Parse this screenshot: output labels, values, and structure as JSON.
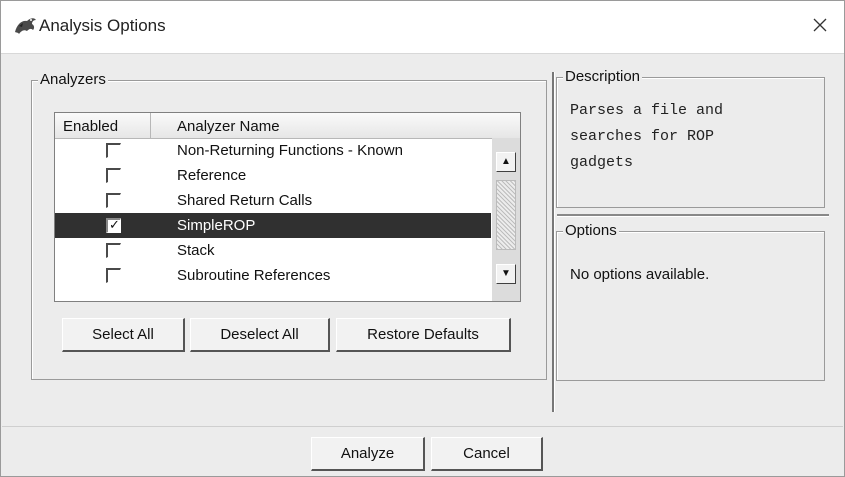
{
  "window": {
    "title": "Analysis Options",
    "icon": "dragon-icon",
    "close_glyph": "✕"
  },
  "analyzers": {
    "legend": "Analyzers",
    "columns": {
      "enabled": "Enabled",
      "name": "Analyzer Name"
    },
    "rows": [
      {
        "label": "Non-Returning Functions - Known",
        "checked": false,
        "selected": false,
        "mark": ""
      },
      {
        "label": "Reference",
        "checked": false,
        "selected": false,
        "mark": ""
      },
      {
        "label": "Shared Return Calls",
        "checked": false,
        "selected": false,
        "mark": ""
      },
      {
        "label": "SimpleROP",
        "checked": true,
        "selected": true,
        "mark": "✓"
      },
      {
        "label": "Stack",
        "checked": false,
        "selected": false,
        "mark": ""
      },
      {
        "label": "Subroutine References",
        "checked": false,
        "selected": false,
        "mark": ""
      }
    ],
    "scroll_up": "▲",
    "scroll_down": "▼",
    "select_all": "Select All",
    "deselect_all": "Deselect All",
    "restore_defaults": "Restore Defaults"
  },
  "description": {
    "legend": "Description",
    "lines": [
      "Parses a file and",
      "searches for ROP",
      "gadgets"
    ]
  },
  "options": {
    "legend": "Options",
    "text": "No options available."
  },
  "footer": {
    "analyze": "Analyze",
    "cancel": "Cancel"
  },
  "colors": {
    "selected_row": "#303030",
    "window_bg": "#ececec"
  }
}
